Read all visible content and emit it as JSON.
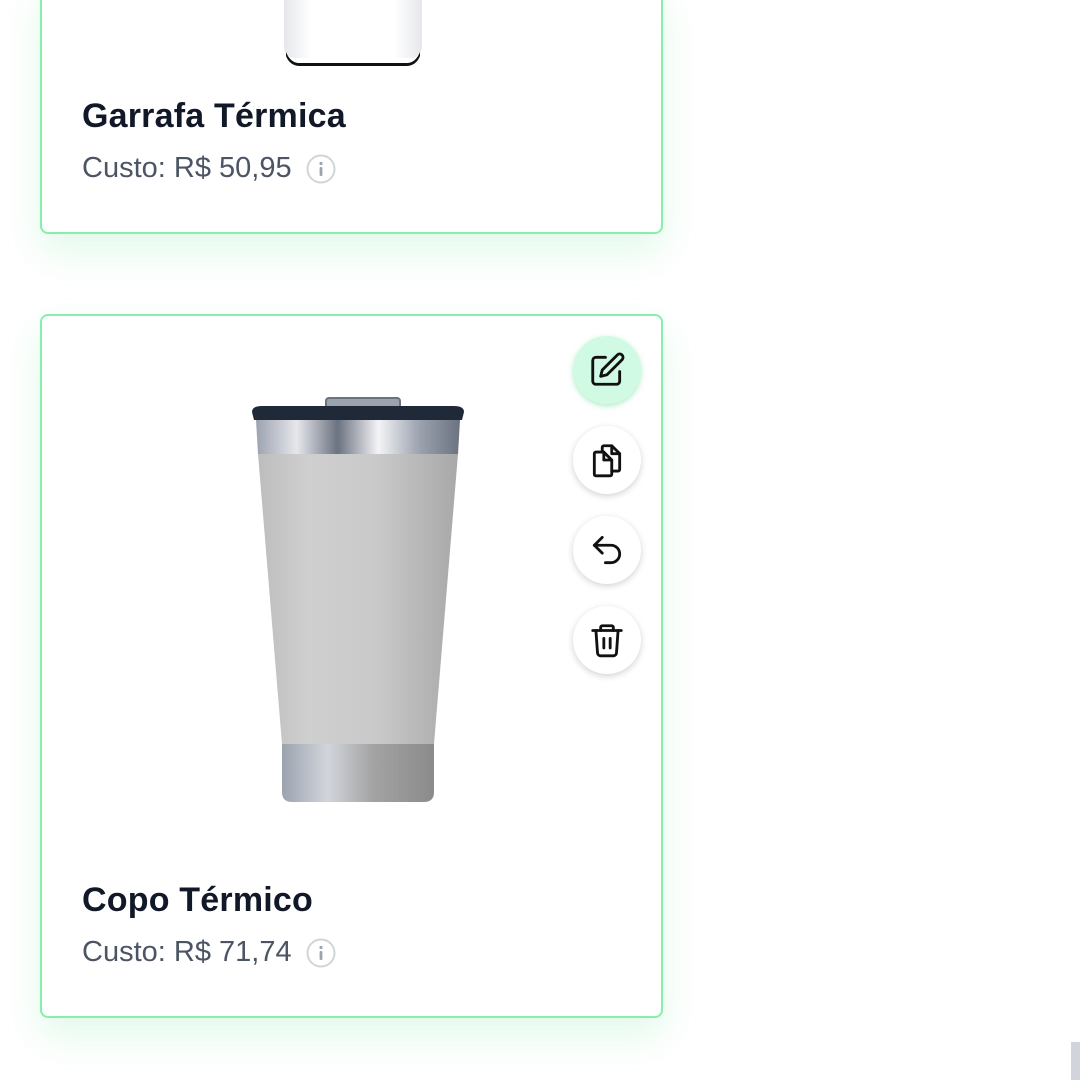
{
  "products": [
    {
      "name": "Garrafa Térmica",
      "cost_label": "Custo:",
      "cost_value": "R$ 50,95"
    },
    {
      "name": "Copo Térmico",
      "cost_label": "Custo:",
      "cost_value": "R$ 71,74"
    }
  ],
  "actions": {
    "edit": "edit-icon",
    "duplicate": "copy-icon",
    "undo": "undo-icon",
    "delete": "trash-icon"
  },
  "colors": {
    "card_border": "#86efac",
    "active_button": "#d1fae5",
    "title": "#111827",
    "price": "#4b5563"
  }
}
